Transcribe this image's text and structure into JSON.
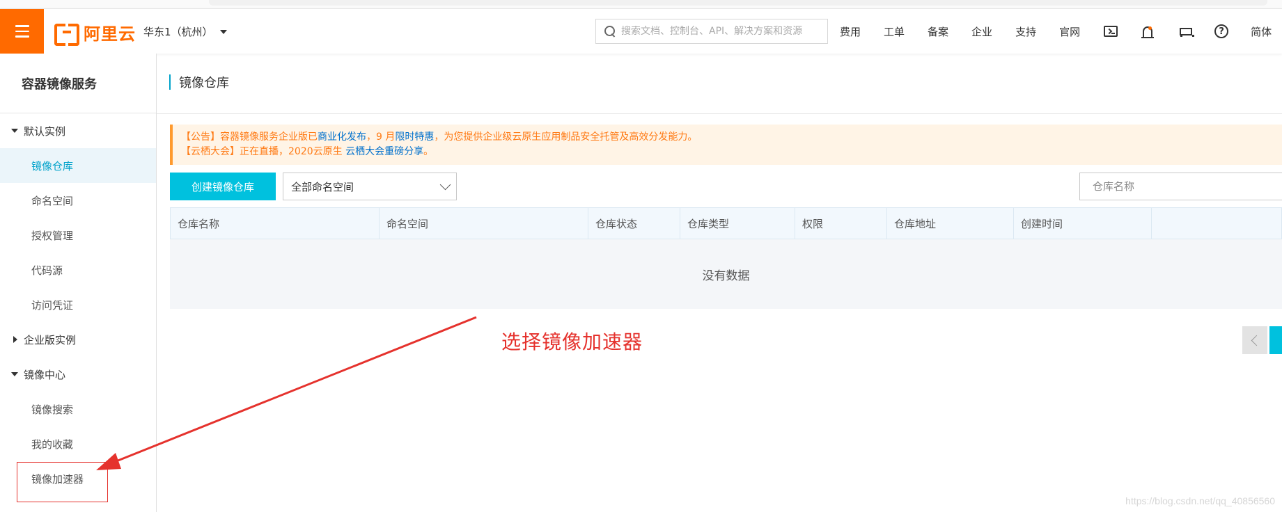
{
  "topbar": {
    "brand": "阿里云",
    "region": "华东1（杭州）",
    "search_placeholder": "搜索文档、控制台、API、解决方案和资源",
    "links": [
      "费用",
      "工单",
      "备案",
      "企业",
      "支持",
      "官网"
    ],
    "lang": "简体",
    "accent_color": "#ff6a00"
  },
  "sidebar": {
    "title": "容器镜像服务",
    "groups": [
      {
        "label": "默认实例",
        "expanded": true,
        "items": [
          "镜像仓库",
          "命名空间",
          "授权管理",
          "代码源",
          "访问凭证"
        ]
      },
      {
        "label": "企业版实例",
        "expanded": false,
        "items": []
      },
      {
        "label": "镜像中心",
        "expanded": true,
        "items": [
          "镜像搜索",
          "我的收藏",
          "镜像加速器"
        ]
      }
    ],
    "active_item": "镜像仓库"
  },
  "main": {
    "page_title": "镜像仓库",
    "notice": {
      "l1_pre": "【公告】容器镜像服务企业版已",
      "l1_link1": "商业化发布",
      "l1_mid": "，9 月",
      "l1_link2": "限时特惠",
      "l1_post": "，为您提供企业级云原生应用制品安全托管及高效分发能力。",
      "l2_pre": "【云栖大会】正在直播，2020云原生 ",
      "l2_link": "云栖大会重磅分享",
      "l2_post": "。"
    },
    "create_button": "创建镜像仓库",
    "namespace_select": "全部命名空间",
    "repo_search_placeholder": "仓库名称",
    "table": {
      "columns": [
        "仓库名称",
        "命名空间",
        "仓库状态",
        "仓库类型",
        "权限",
        "仓库地址",
        "创建时间",
        ""
      ],
      "empty_text": "没有数据"
    }
  },
  "annotation": {
    "text": "选择镜像加速器",
    "color": "#e5322d"
  },
  "watermark": "https://blog.csdn.net/qq_40856560"
}
